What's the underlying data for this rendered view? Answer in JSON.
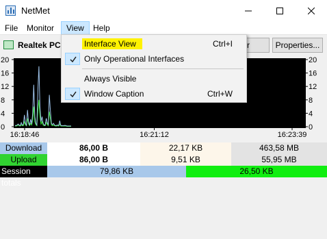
{
  "window": {
    "title": "NetMet",
    "icon": "netmet-app-icon"
  },
  "menubar": {
    "file": "File",
    "monitor": "Monitor",
    "view": "View",
    "help": "Help"
  },
  "toolbar": {
    "interface_name": "Realtek PC",
    "combo_value": "r",
    "properties_label": "Properties..."
  },
  "view_menu": {
    "interface_view": {
      "label": "Interface View",
      "shortcut": "Ctrl+I",
      "highlighted": true
    },
    "only_operational": {
      "label": "Only Operational Interfaces",
      "checked": true
    },
    "always_visible": {
      "label": "Always Visible",
      "checked": false
    },
    "window_caption": {
      "label": "Window Caption",
      "shortcut": "Ctrl+W",
      "checked": true
    }
  },
  "graph": {
    "y_ticks_left": [
      "20",
      "16",
      "12",
      "8",
      "4",
      "0"
    ],
    "y_ticks_right": [
      "20",
      "16",
      "12",
      "8",
      "4",
      "0"
    ],
    "x_ticks": [
      "16:18:46",
      "16:21:12",
      "16:23:39"
    ],
    "y_max": 20,
    "colors": {
      "download": "#9fc3ea",
      "upload": "#33e633",
      "background": "#000000"
    },
    "download_series": [
      0.4,
      0.3,
      0.5,
      0.8,
      0.4,
      0.3,
      1.2,
      0.5,
      0.6,
      3.5,
      1.0,
      0.4,
      5.0,
      1.5,
      0.4,
      2.2,
      0.8,
      4.0,
      12.5,
      3.0,
      1.0,
      0.5,
      11.0,
      18.0,
      6.0,
      1.5,
      3.0,
      1.0,
      0.5,
      0.4,
      2.5,
      1.2,
      0.5,
      9.5,
      5.0,
      1.0,
      0.6,
      1.0,
      0.5,
      0.3,
      0.4,
      0.5,
      0.3,
      1.8,
      0.4,
      0.3,
      0.3,
      0.3,
      0.4,
      0.3,
      0.2,
      0.2,
      0.2,
      0.2,
      0.2
    ],
    "upload_series": [
      0.2,
      0.2,
      0.3,
      0.5,
      0.3,
      0.2,
      0.6,
      0.3,
      0.3,
      1.5,
      0.5,
      0.3,
      2.5,
      0.8,
      0.3,
      1.0,
      0.5,
      2.0,
      6.0,
      1.5,
      0.6,
      0.3,
      5.0,
      8.0,
      3.0,
      0.8,
      1.5,
      0.5,
      0.3,
      0.3,
      1.3,
      0.6,
      0.3,
      4.5,
      2.5,
      0.5,
      0.3,
      0.5,
      0.3,
      0.2,
      0.2,
      0.3,
      0.2,
      0.8,
      0.2,
      0.2,
      0.2,
      0.2,
      0.2,
      0.2,
      0.1,
      0.1,
      0.1,
      0.1,
      0.1
    ]
  },
  "stats": {
    "download": {
      "label": "Download",
      "rate": "86,00 B",
      "mid": "22,17 KB",
      "total": "463,58 MB"
    },
    "upload": {
      "label": "Upload",
      "rate": "86,00 B",
      "mid": "9,51 KB",
      "total": "55,95 MB"
    },
    "session": {
      "label": "Session totals",
      "download": "79,86 KB",
      "upload": "26,50 KB"
    }
  }
}
